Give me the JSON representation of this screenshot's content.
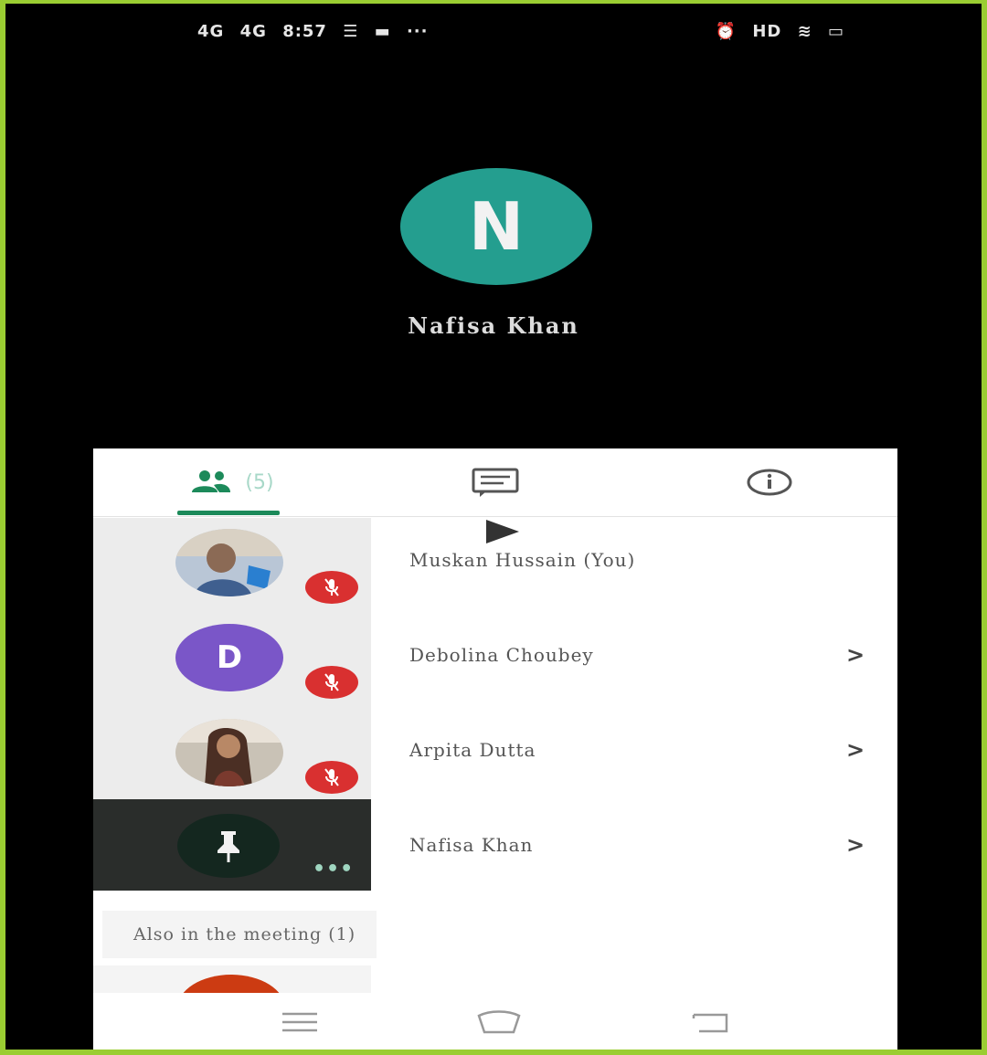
{
  "status_bar": {
    "left": [
      "4G",
      "4G",
      "8:57",
      "☰",
      "▬",
      "···"
    ],
    "right": [
      "⏰",
      "HD",
      "≋",
      "▭"
    ]
  },
  "speaker": {
    "initial": "N",
    "name": "Nafisa Khan",
    "avatar_color": "#249e8f"
  },
  "tabs": {
    "people_count": "(5)",
    "active_tab": "people"
  },
  "participants": [
    {
      "name": "Muskan Hussain (You)",
      "avatar": "photo",
      "muted": true
    },
    {
      "name": "Debolina Choubey",
      "avatar": "letter",
      "initial": "D",
      "muted": true
    },
    {
      "name": "Arpita Dutta",
      "avatar": "photo",
      "muted": true
    },
    {
      "name": "Nafisa Khan",
      "avatar": "pinned",
      "muted": false
    }
  ],
  "presenter_more": "•••",
  "section_header": "Also in the meeting (1)",
  "colors": {
    "accent_green": "#1c8a5a",
    "mute_red": "#d93030",
    "letter_avatar": "#7a56c8",
    "partial_avatar": "#cc3b12"
  }
}
